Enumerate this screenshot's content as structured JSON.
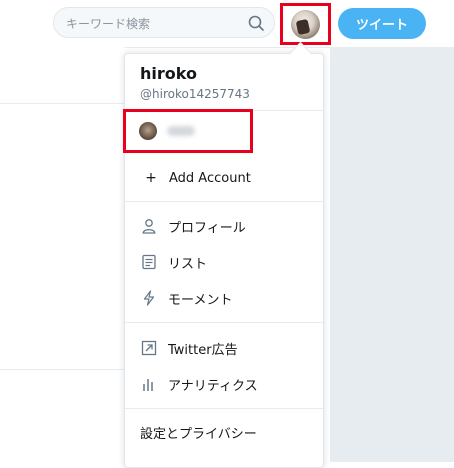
{
  "header": {
    "search": {
      "placeholder": "キーワード検索"
    },
    "tweet_button": "ツイート"
  },
  "account_menu": {
    "display_name": "hiroko",
    "handle": "@hiroko14257743",
    "add_account": "Add Account",
    "items": [
      {
        "label": "プロフィール",
        "icon": "person-icon"
      },
      {
        "label": "リスト",
        "icon": "list-icon"
      },
      {
        "label": "モーメント",
        "icon": "lightning-icon"
      },
      {
        "label": "Twitter広告",
        "icon": "external-link-icon"
      },
      {
        "label": "アナリティクス",
        "icon": "bar-chart-icon"
      }
    ],
    "settings": "設定とプライバシー"
  },
  "colors": {
    "accent": "#4ab3f4",
    "highlight": "#e8001c",
    "icon": "#657786"
  }
}
